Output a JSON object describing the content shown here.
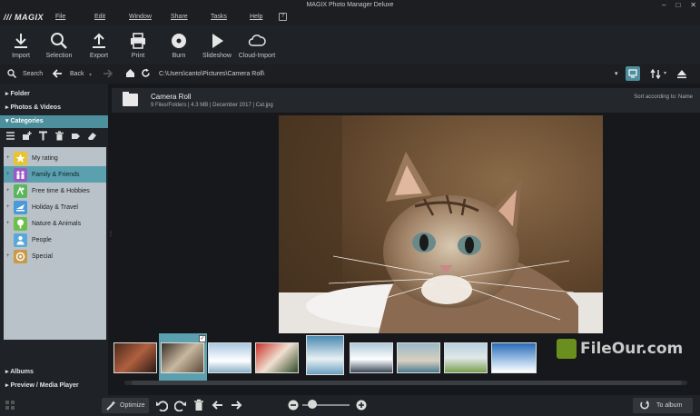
{
  "window": {
    "title": "MAGIX Photo Manager Deluxe",
    "controls": [
      "–",
      "□",
      "✕"
    ]
  },
  "menubar": {
    "logo": "/// MAGIX",
    "items": [
      "File",
      "Edit",
      "Window",
      "Share",
      "Tasks",
      "Help"
    ]
  },
  "toolbar": {
    "import": "Import",
    "selection": "Selection",
    "export": "Export",
    "print": "Print",
    "burn": "Burn",
    "slideshow": "Slideshow",
    "cloud_import": "Cloud-Import"
  },
  "navbar": {
    "search": "Search",
    "back": "Back",
    "path": "C:\\Users\\canto\\Pictures\\Camera Roll\\"
  },
  "sidebar": {
    "folder": "Folder",
    "photos_videos": "Photos & Videos",
    "categories": "Categories",
    "items": [
      {
        "label": "My rating",
        "color": "#e8c431"
      },
      {
        "label": "Family & Friends",
        "color": "#9b59c6"
      },
      {
        "label": "Free time & Hobbies",
        "color": "#5bb55b"
      },
      {
        "label": "Holiday & Travel",
        "color": "#4a9ad8"
      },
      {
        "label": "Nature & Animals",
        "color": "#6cc04a"
      },
      {
        "label": "People",
        "color": "#5aa8d8"
      },
      {
        "label": "Special",
        "color": "#c89a4a"
      }
    ],
    "albums": "Albums",
    "preview": "Preview / Media Player"
  },
  "folder_header": {
    "name": "Camera Roll",
    "info": "9 Files/Folders  |  4.3 MB  |  December 2017  |  Cat.jpg",
    "sort": "Sort according to: Name"
  },
  "watermark": "FileOur.com",
  "statusbar": {
    "optimize": "Optimize",
    "to_album": "To album"
  },
  "colors": {
    "accent": "#4d8f9c",
    "selection": "#5aa0ae",
    "background": "#16181b"
  }
}
